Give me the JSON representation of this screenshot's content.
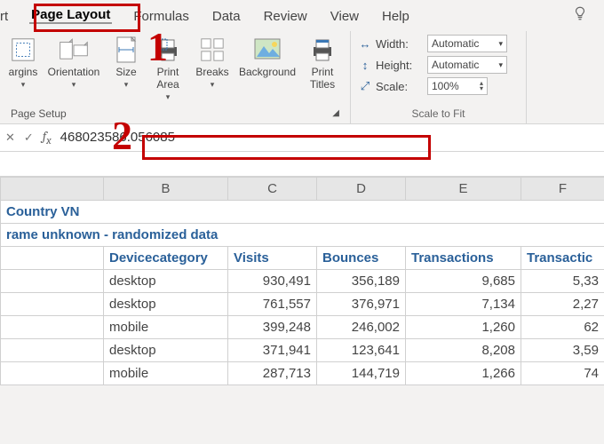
{
  "tabs": {
    "rt": "rt",
    "items": [
      "Page Layout",
      "Formulas",
      "Data",
      "Review",
      "View",
      "Help"
    ],
    "active_index": 0
  },
  "ribbon": {
    "page_setup": {
      "margins": "argins",
      "orientation": "Orientation",
      "size": "Size",
      "print_area": "Print\nArea",
      "breaks": "Breaks",
      "background": "Background",
      "print_titles": "Print\nTitles",
      "group_label": "Page Setup"
    },
    "scale": {
      "width_lbl": "Width:",
      "width_val": "Automatic",
      "height_lbl": "Height:",
      "height_val": "Automatic",
      "scale_lbl": "Scale:",
      "scale_val": "100%",
      "group_label": "Scale to Fit"
    }
  },
  "fx": {
    "value": "468023586.056085"
  },
  "sheet": {
    "col_headers": [
      "B",
      "C",
      "D",
      "E",
      "F"
    ],
    "title1": "Country VN",
    "title2": "rame unknown - randomized data",
    "headers": [
      "Devicecategory",
      "Visits",
      "Bounces",
      "Transactions",
      "Transactic"
    ],
    "rows": [
      {
        "dev": "desktop",
        "visits": "930,491",
        "bounces": "356,189",
        "trans": "9,685",
        "tr": "5,33"
      },
      {
        "dev": "desktop",
        "visits": "761,557",
        "bounces": "376,971",
        "trans": "7,134",
        "tr": "2,27"
      },
      {
        "dev": "mobile",
        "visits": "399,248",
        "bounces": "246,002",
        "trans": "1,260",
        "tr": "62"
      },
      {
        "dev": "desktop",
        "visits": "371,941",
        "bounces": "123,641",
        "trans": "8,208",
        "tr": "3,59"
      },
      {
        "dev": "mobile",
        "visits": "287,713",
        "bounces": "144,719",
        "trans": "1,266",
        "tr": "74"
      }
    ]
  },
  "callouts": {
    "one": "1",
    "two": "2"
  }
}
